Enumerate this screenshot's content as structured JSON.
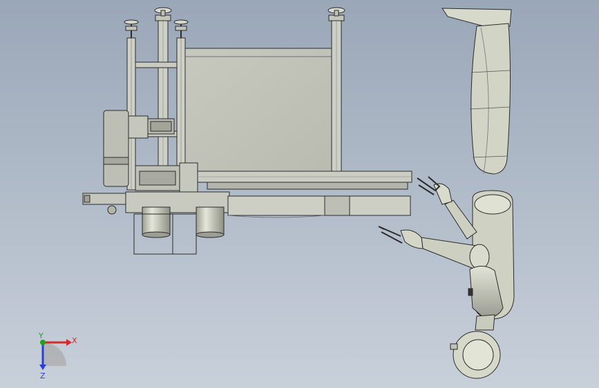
{
  "viewport": {
    "background_top": "#9aa7b8",
    "background_bottom": "#c8d0da"
  },
  "model": {
    "metal_color": "#c9cbc3",
    "metal_dark": "#a9aba3",
    "edge_color": "#2b2b2b",
    "robot_color": "#d2d4c6",
    "robot_shadow": "#9c9e90"
  },
  "triad": {
    "x_label": "X",
    "y_label": "Y",
    "z_label": "Z",
    "x_color": "#d42a2a",
    "y_color": "#1fa31f",
    "z_color": "#2a3fd4"
  }
}
